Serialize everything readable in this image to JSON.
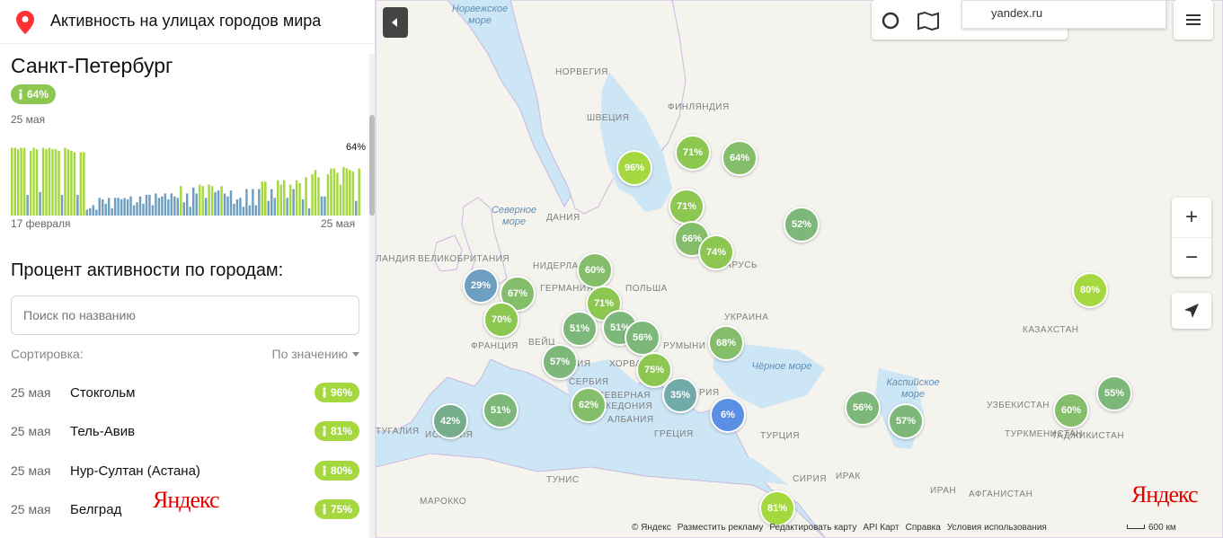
{
  "header": {
    "title": "Активность на улицах городов мира"
  },
  "city": {
    "name": "Санкт-Петербург",
    "pill": "64%",
    "date": "25 мая",
    "chart_value_label": "64%",
    "chart_start": "17 февраля",
    "chart_end": "25 мая"
  },
  "chart_data": {
    "type": "bar",
    "series": [
      {
        "values": [
          92,
          92,
          90,
          92,
          92,
          28,
          88,
          92,
          90,
          32,
          92,
          90,
          92,
          90,
          90,
          88,
          28,
          92,
          90,
          88,
          86,
          28,
          86,
          86,
          8,
          10,
          14,
          8,
          24,
          22,
          16,
          24,
          10,
          24,
          24,
          22,
          24,
          22,
          26,
          14,
          18,
          26,
          16,
          28,
          28,
          14,
          30,
          24,
          26,
          30,
          22,
          30,
          26,
          24,
          40,
          18,
          30,
          12,
          38,
          30,
          42,
          40,
          24,
          42,
          40,
          32,
          34,
          40,
          30,
          26,
          34,
          16,
          22,
          24,
          12,
          36,
          14,
          36,
          14,
          36,
          46,
          46,
          20,
          36,
          24,
          48,
          42,
          48,
          24,
          42,
          36,
          48,
          44,
          22,
          52,
          10,
          56,
          62,
          52,
          26,
          26,
          56,
          64,
          64,
          58,
          42,
          66,
          64,
          62,
          60,
          20,
          64
        ]
      }
    ],
    "ylim": [
      0,
      100
    ]
  },
  "list": {
    "title": "Процент активности по городам:",
    "search_placeholder": "Поиск по названию",
    "sort_label": "Сортировка:",
    "sort_value": "По значению",
    "rows": [
      {
        "date": "25 мая",
        "name": "Стокгольм",
        "value": "96%",
        "color": "#a5d83f"
      },
      {
        "date": "25 мая",
        "name": "Тель-Авив",
        "value": "81%",
        "color": "#a5d83f"
      },
      {
        "date": "25 мая",
        "name": "Нур-Султан (Астана)",
        "value": "80%",
        "color": "#a5d83f"
      },
      {
        "date": "25 мая",
        "name": "Белград",
        "value": "75%",
        "color": "#a5d83f"
      }
    ]
  },
  "panel_logo": "Яндекс",
  "map": {
    "url": "yandex.ru",
    "countries": [
      "НОРВЕГИЯ",
      "ФИНЛЯНДИЯ",
      "ШВЕЦИЯ",
      "ДАНИЯ",
      "ВЕЛИКОБРИТАНИЯ",
      "ЛАНДИЯ",
      "НИДЕРЛАН",
      "ГЕРМАНИЯ",
      "ПОЛЬША",
      "БЕЛАРУСЬ",
      "УКРАИНА",
      "ФРАНЦИЯ",
      "ВЕЙЦ",
      "ХОРВАТИ",
      "РУМЫНИ",
      "СЕРБИЯ",
      "СЕВЕРНАЯ",
      "МАКЕДОНИЯ",
      "АЛБАНИЯ",
      "ГРЕЦИЯ",
      "РИЯ",
      "ИСПАНИЯ",
      "ТУГАЛИЯ",
      "КАЗАХСТАН",
      "УЗБЕКИСТАН",
      "ТУРКМЕНИСТАН",
      "ТАДЖИКИСТАН",
      "ТУРЦИЯ",
      "СИРИЯ",
      "ИРАК",
      "ИРАН",
      "АФГАНИСТАН",
      "ТУНИС",
      "МАРОККО",
      "ИЯ"
    ],
    "seas": [
      "Норвежское море",
      "Северное море",
      "Чёрное море",
      "Каспийское море"
    ],
    "bubbles": [
      {
        "value": "96%",
        "color": "#a5d83f"
      },
      {
        "value": "71%",
        "color": "#8cc751"
      },
      {
        "value": "64%",
        "color": "#84be6a"
      },
      {
        "value": "71%",
        "color": "#8cc751"
      },
      {
        "value": "52%",
        "color": "#7db87a"
      },
      {
        "value": "66%",
        "color": "#84be6a"
      },
      {
        "value": "74%",
        "color": "#8cc751"
      },
      {
        "value": "60%",
        "color": "#84be6a"
      },
      {
        "value": "71%",
        "color": "#8cc751"
      },
      {
        "value": "29%",
        "color": "#6e9fc0"
      },
      {
        "value": "67%",
        "color": "#84be6a"
      },
      {
        "value": "70%",
        "color": "#8cc751"
      },
      {
        "value": "51%",
        "color": "#7db87a"
      },
      {
        "value": "51%",
        "color": "#7db87a"
      },
      {
        "value": "56%",
        "color": "#7db87a"
      },
      {
        "value": "68%",
        "color": "#84be6a"
      },
      {
        "value": "80%",
        "color": "#a5d83f"
      },
      {
        "value": "57%",
        "color": "#7db87a"
      },
      {
        "value": "75%",
        "color": "#8cc751"
      },
      {
        "value": "35%",
        "color": "#72a9a9"
      },
      {
        "value": "6%",
        "color": "#5b8fe4"
      },
      {
        "value": "42%",
        "color": "#75ad8c"
      },
      {
        "value": "51%",
        "color": "#7db87a"
      },
      {
        "value": "62%",
        "color": "#84be6a"
      },
      {
        "value": "56%",
        "color": "#7db87a"
      },
      {
        "value": "57%",
        "color": "#7db87a"
      },
      {
        "value": "60%",
        "color": "#84be6a"
      },
      {
        "value": "55%",
        "color": "#7db87a"
      },
      {
        "value": "81%",
        "color": "#a5d83f"
      }
    ],
    "footer": [
      "© Яндекс",
      "Разместить рекламу",
      "Редактировать карту",
      "API Карт",
      "Справка",
      "Условия использования"
    ],
    "scale": "600 км",
    "logo": "Яндекс",
    "zoom_in": "+",
    "zoom_out": "−"
  }
}
